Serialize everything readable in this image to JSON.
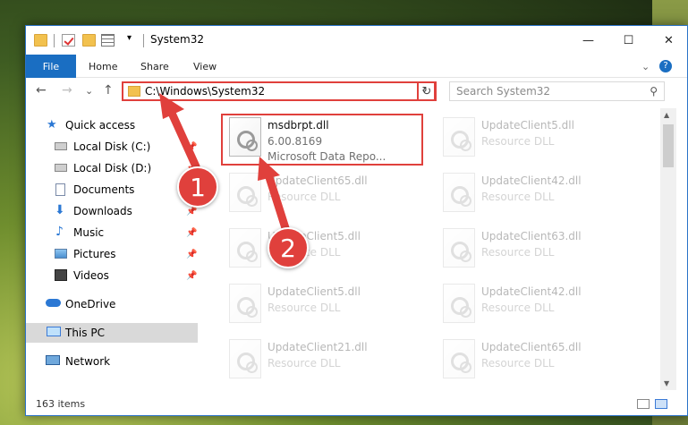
{
  "window": {
    "title": "System32",
    "controls": {
      "minimize": "—",
      "maximize": "☐",
      "close": "✕"
    }
  },
  "ribbon": {
    "tabs": [
      "File",
      "Home",
      "Share",
      "View"
    ],
    "expand_icon": "⌄",
    "help_icon": "?"
  },
  "nav": {
    "back": "←",
    "forward": "→",
    "recent": "⌄",
    "up": "↑",
    "address": "C:\\Windows\\System32",
    "address_dropdown": "⌄",
    "refresh": "↻",
    "search_placeholder": "Search System32",
    "search_icon": "⚲"
  },
  "sidebar": {
    "items": [
      {
        "label": "Quick access",
        "icon": "star-icon",
        "pinned": false
      },
      {
        "label": "Local Disk (C:)",
        "icon": "drive-icon",
        "pinned": true
      },
      {
        "label": "Local Disk (D:)",
        "icon": "drive-icon",
        "pinned": true
      },
      {
        "label": "Documents",
        "icon": "documents-icon",
        "pinned": true
      },
      {
        "label": "Downloads",
        "icon": "downloads-icon",
        "pinned": true
      },
      {
        "label": "Music",
        "icon": "music-icon",
        "pinned": true
      },
      {
        "label": "Pictures",
        "icon": "pictures-icon",
        "pinned": true
      },
      {
        "label": "Videos",
        "icon": "videos-icon",
        "pinned": true
      },
      {
        "label": "OneDrive",
        "icon": "cloud-icon",
        "pinned": false
      },
      {
        "label": "This PC",
        "icon": "computer-icon",
        "pinned": false,
        "selected": true
      },
      {
        "label": "Network",
        "icon": "network-icon",
        "pinned": false
      }
    ],
    "pin_glyph": "📌"
  },
  "files": [
    {
      "name": "msdbrpt.dll",
      "line2": "6.00.8169",
      "line3": "Microsoft Data Repo...",
      "highlighted": true
    },
    {
      "name": "UpdateClient5.dll",
      "line2": "Resource DLL",
      "faded": true
    },
    {
      "name": "UpdateClient65.dll",
      "line2": "Resource DLL",
      "faded": true
    },
    {
      "name": "UpdateClient42.dll",
      "line2": "Resource DLL",
      "faded": true
    },
    {
      "name": "UpdateClient5.dll",
      "line2": "Resource DLL",
      "faded": true
    },
    {
      "name": "UpdateClient63.dll",
      "line2": "Resource DLL",
      "faded": true
    },
    {
      "name": "UpdateClient5.dll",
      "line2": "Resource DLL",
      "faded": true
    },
    {
      "name": "UpdateClient42.dll",
      "line2": "Resource DLL",
      "faded": true
    },
    {
      "name": "UpdateClient21.dll",
      "line2": "Resource DLL",
      "faded": true
    },
    {
      "name": "UpdateClient65.dll",
      "line2": "Resource DLL",
      "faded": true
    }
  ],
  "status": {
    "item_count": "163 items"
  },
  "annotations": {
    "step1": "1",
    "step2": "2",
    "color": "#e0403c"
  }
}
